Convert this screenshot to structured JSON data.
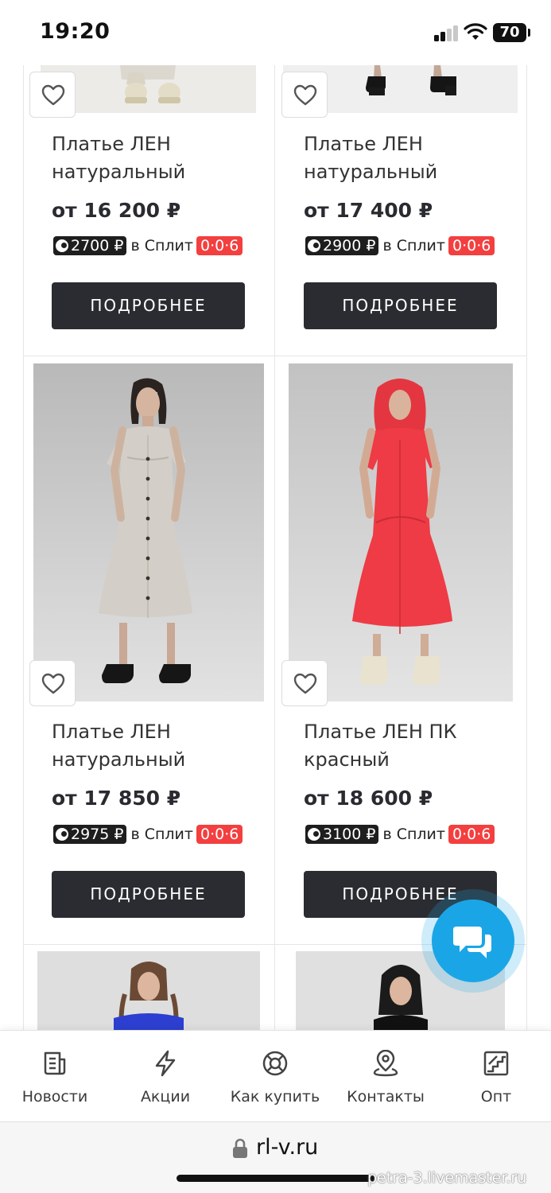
{
  "status_bar": {
    "time": "19:20",
    "battery": "70"
  },
  "split_text": "в Сплит",
  "split_rate": "0·0·6",
  "products": [
    {
      "title": "Платье ЛЕН натуральный",
      "price": "от 16 200 ₽",
      "split_amount": "2700 ₽",
      "button": "ПОДРОБНЕЕ"
    },
    {
      "title": "Платье ЛЕН натуральный",
      "price": "от 17 400 ₽",
      "split_amount": "2900 ₽",
      "button": "ПОДРОБНЕЕ"
    },
    {
      "title": "Платье ЛЕН натуральный",
      "price": "от 17 850 ₽",
      "split_amount": "2975 ₽",
      "button": "ПОДРОБНЕЕ"
    },
    {
      "title": "Платье ЛЕН ПК красный",
      "price": "от 18 600 ₽",
      "split_amount": "3100 ₽",
      "button": "ПОДРОБНЕЕ"
    }
  ],
  "bottom_nav": {
    "items": [
      {
        "label": "Новости",
        "icon": "news-icon"
      },
      {
        "label": "Акции",
        "icon": "lightning-icon"
      },
      {
        "label": "Как купить",
        "icon": "lifebuoy-icon"
      },
      {
        "label": "Контакты",
        "icon": "location-pin-icon"
      },
      {
        "label": "Опт",
        "icon": "stairs-icon"
      }
    ]
  },
  "browser": {
    "url": "rl-v.ru",
    "watermark": "petra-3.livemaster.ru"
  },
  "colors": {
    "button_dark": "#2b2c31",
    "split_red": "#f33f3f",
    "chat_blue": "#1aa6e6"
  }
}
